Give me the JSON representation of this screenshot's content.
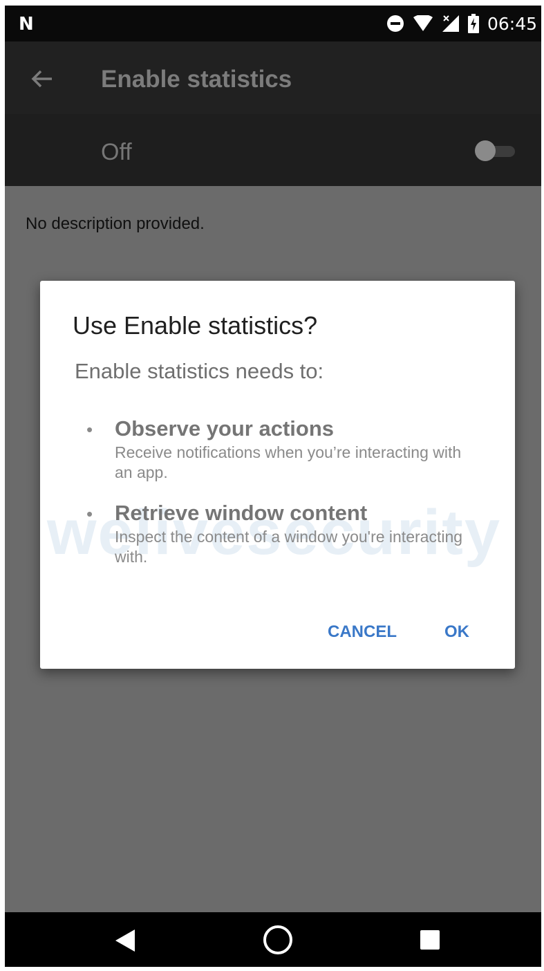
{
  "status_bar": {
    "time": "06:45",
    "icons": [
      "n-logo-icon",
      "do-not-disturb-icon",
      "wifi-icon",
      "signal-icon",
      "battery-icon"
    ]
  },
  "app_bar": {
    "title": "Enable statistics",
    "back_icon": "arrow-left-icon"
  },
  "switch_bar": {
    "label": "Off",
    "checked": false
  },
  "description": "No description provided.",
  "dialog": {
    "title": "Use Enable statistics?",
    "subtitle": "Enable statistics needs to:",
    "bullet": "•",
    "permissions": [
      {
        "title": "Observe your actions",
        "description": "Receive notifications when you’re interacting with an app."
      },
      {
        "title": "Retrieve window content",
        "description": "Inspect the content of a window you're interacting with."
      }
    ],
    "cancel_label": "CANCEL",
    "ok_label": "OK",
    "accent_color": "#3a78c8"
  },
  "watermark": "welivesecurity",
  "nav_bar": {
    "icons": [
      "back-triangle-icon",
      "home-circle-icon",
      "recents-square-icon"
    ]
  }
}
